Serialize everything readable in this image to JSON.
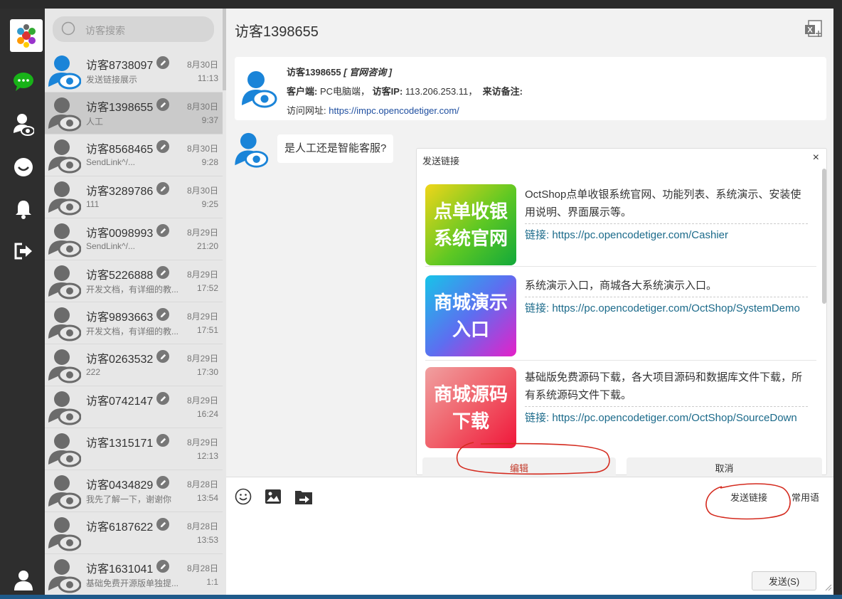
{
  "sidebar": {
    "icons": [
      "logo-icon",
      "chat-icon",
      "visitor-icon",
      "smile-icon",
      "bell-icon",
      "logout-icon",
      "user-icon"
    ]
  },
  "search": {
    "placeholder": "访客搜索"
  },
  "conversations": [
    {
      "name": "访客8738097",
      "date": "8月30日",
      "msg": "发送链接展示",
      "time": "11:13"
    },
    {
      "name": "访客1398655",
      "date": "8月30日",
      "msg": "人工",
      "time": "9:37"
    },
    {
      "name": "访客8568465",
      "date": "8月30日",
      "msg": "SendLink^/...",
      "time": "9:28"
    },
    {
      "name": "访客3289786",
      "date": "8月30日",
      "msg": "111",
      "time": "9:25"
    },
    {
      "name": "访客0098993",
      "date": "8月29日",
      "msg": "SendLink^/...",
      "time": "21:20"
    },
    {
      "name": "访客5226888",
      "date": "8月29日",
      "msg": "开发文档，有详细的教...",
      "time": "17:52"
    },
    {
      "name": "访客9893663",
      "date": "8月29日",
      "msg": "开发文档，有详细的教...",
      "time": "17:51"
    },
    {
      "name": "访客0263532",
      "date": "8月29日",
      "msg": "222",
      "time": "17:30"
    },
    {
      "name": "访客0742147",
      "date": "8月29日",
      "msg": "",
      "time": "16:24"
    },
    {
      "name": "访客1315171",
      "date": "8月29日",
      "msg": "",
      "time": "12:13"
    },
    {
      "name": "访客0434829",
      "date": "8月28日",
      "msg": "我先了解一下，谢谢你",
      "time": "13:54"
    },
    {
      "name": "访客6187622",
      "date": "8月28日",
      "msg": "",
      "time": "13:53"
    },
    {
      "name": "访客1631041",
      "date": "8月28日",
      "msg": "基础免费开源版单独提...",
      "time": "1:1"
    }
  ],
  "chat": {
    "title": "访客1398655",
    "info": {
      "name": "访客1398655",
      "source": "[ 官网咨询 ]",
      "client_label": "客户端:",
      "client_value": "PC电脑端，",
      "ip_label": "访客IP:",
      "ip_value": "113.206.253.11，",
      "note_label": "来访备注:",
      "url_label": "访问网址:",
      "url_value": "https://impc.opencodetiger.com/"
    },
    "message": "是人工还是智能客服?"
  },
  "popup": {
    "title": "发送链接",
    "close": "×",
    "items": [
      {
        "thumb": "点单收银系统官网",
        "desc": "OctShop点单收银系统官网、功能列表、系统演示、安装使用说明、界面展示等。",
        "link_label": "链接:",
        "url": "https://pc.opencodetiger.com/Cashier"
      },
      {
        "thumb": "商城演示入口",
        "desc": "系统演示入口，商城各大系统演示入口。",
        "link_label": "链接:",
        "url": "https://pc.opencodetiger.com/OctShop/SystemDemo"
      },
      {
        "thumb": "商城源码下载",
        "desc": "基础版免费源码下载，各大项目源码和数据库文件下载，所有系统源码文件下载。",
        "link_label": "链接:",
        "url": "https://pc.opencodetiger.com/OctShop/SourceDown"
      }
    ],
    "edit_label": "编辑",
    "cancel_label": "取消"
  },
  "input": {
    "send_link_label": "发送链接",
    "common_phrases_label": "常用语",
    "send_label": "发送(S)"
  }
}
